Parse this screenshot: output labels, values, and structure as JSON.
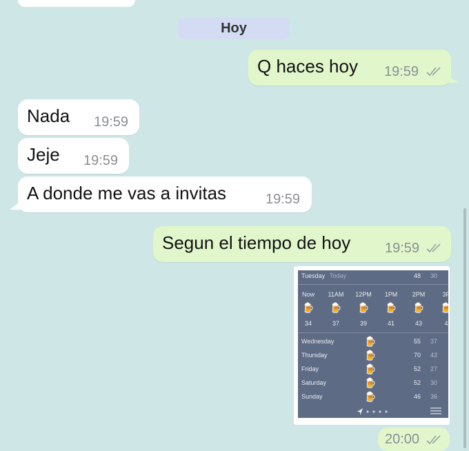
{
  "chat": {
    "date_chip": "Hoy",
    "messages": [
      {
        "text": "Q haces hoy",
        "time": "19:59"
      },
      {
        "text": "Nada",
        "time": "19:59"
      },
      {
        "text": "Jeje",
        "time": "19:59"
      },
      {
        "text": "A donde me vas a invitas",
        "time": "19:59"
      },
      {
        "text": "Segun el tiempo de hoy",
        "time": "19:59"
      },
      {
        "time": "20:00"
      }
    ]
  },
  "weather": {
    "day": "Tuesday",
    "today_label": "Today",
    "hi": "48",
    "lo": "30",
    "hours": [
      {
        "label": "Now",
        "temp": "34",
        "icon": "beer-icon"
      },
      {
        "label": "11AM",
        "temp": "37",
        "icon": "beer-icon"
      },
      {
        "label": "12PM",
        "temp": "39",
        "icon": "beer-icon"
      },
      {
        "label": "1PM",
        "temp": "41",
        "icon": "beer-icon"
      },
      {
        "label": "2PM",
        "temp": "43",
        "icon": "beer-icon"
      },
      {
        "label": "3P",
        "temp": "4",
        "icon": "beer-icon"
      }
    ],
    "days": [
      {
        "name": "Wednesday",
        "hi": "55",
        "lo": "37",
        "icon": "beer-icon"
      },
      {
        "name": "Thursday",
        "hi": "70",
        "lo": "43",
        "icon": "beer-icon"
      },
      {
        "name": "Friday",
        "hi": "52",
        "lo": "27",
        "icon": "beer-icon"
      },
      {
        "name": "Saturday",
        "hi": "52",
        "lo": "30",
        "icon": "beer-icon"
      },
      {
        "name": "Sunday",
        "hi": "46",
        "lo": "36",
        "icon": "beer-icon"
      }
    ],
    "beer_glyph": "🍺"
  },
  "colors": {
    "background": "#cfe6e6",
    "outgoing_bubble": "#e1f7cb",
    "incoming_bubble": "#ffffff",
    "date_chip": "#d3dcf3",
    "weather_panel": "#5e6b84"
  }
}
